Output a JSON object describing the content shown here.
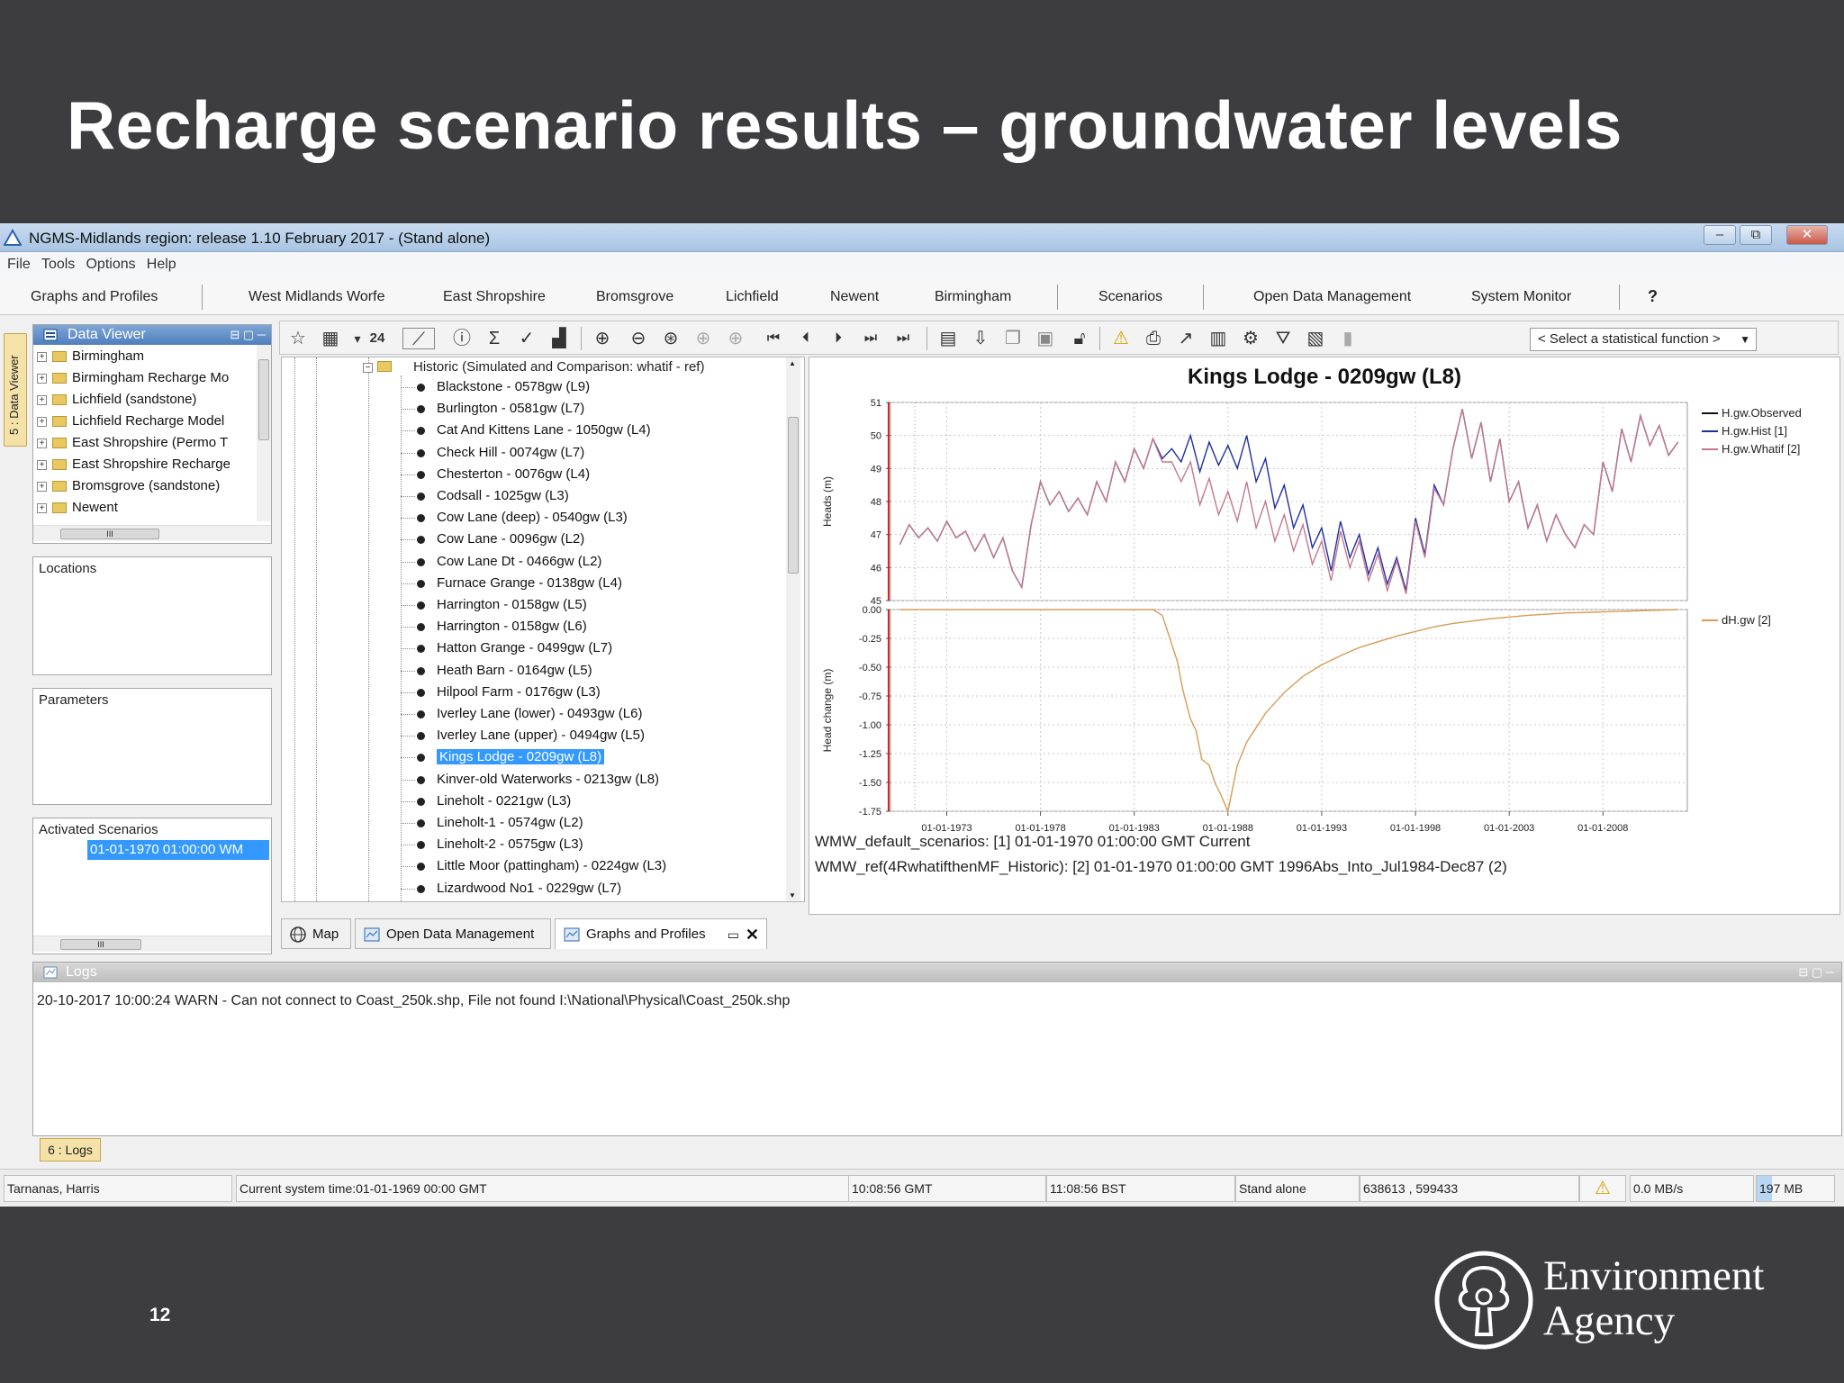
{
  "slide": {
    "title": "Recharge scenario results – groundwater levels",
    "page_number": "12",
    "logo_line1": "Environment",
    "logo_line2": "Agency"
  },
  "window": {
    "title": "NGMS-Midlands region: release 1.10 February 2017 - (Stand alone)",
    "buttons": [
      "–",
      "⧉",
      "✕"
    ]
  },
  "menu": [
    "File",
    "Tools",
    "Options",
    "Help"
  ],
  "tabs": [
    "Graphs and Profiles",
    "West Midlands Worfe",
    "East Shropshire",
    "Bromsgrove",
    "Lichfield",
    "Newent",
    "Birmingham",
    "Scenarios",
    "Open Data Management",
    "System Monitor",
    "?"
  ],
  "side_strip": "5 : Data Viewer",
  "data_viewer": {
    "title": "Data Viewer",
    "items": [
      "Birmingham",
      "Birmingham Recharge Mo",
      "Lichfield (sandstone)",
      "Lichfield Recharge Model",
      "East Shropshire (Permo T",
      "East Shropshire Recharge",
      "Bromsgrove (sandstone)",
      "Newent"
    ],
    "scroll_label": "III"
  },
  "locations_label": "Locations",
  "parameters_label": "Parameters",
  "activated": {
    "label": "Activated Scenarios",
    "item": "01-01-1970 01:00:00  WM",
    "scroll_label": "III"
  },
  "toolbar": {
    "stat_select": "< Select a statistical function >"
  },
  "loc_tree": {
    "root": "Historic (Simulated and Comparison: whatif - ref)",
    "items": [
      "Blackstone - 0578gw (L9)",
      "Burlington - 0581gw (L7)",
      "Cat And Kittens Lane - 1050gw (L4)",
      "Check Hill - 0074gw (L7)",
      "Chesterton - 0076gw (L4)",
      "Codsall - 1025gw (L3)",
      "Cow Lane (deep) - 0540gw (L3)",
      "Cow Lane - 0096gw (L2)",
      "Cow Lane Dt - 0466gw (L2)",
      "Furnace Grange - 0138gw (L4)",
      "Harrington - 0158gw (L5)",
      "Harrington - 0158gw (L6)",
      "Hatton Grange - 0499gw (L7)",
      "Heath Barn - 0164gw (L5)",
      "Hilpool Farm - 0176gw (L3)",
      "Iverley Lane (lower) - 0493gw (L6)",
      "Iverley Lane (upper) - 0494gw (L5)",
      "Kings Lodge - 0209gw (L8)",
      "Kinver-old Waterworks - 0213gw (L8)",
      "Lineholt - 0221gw (L3)",
      "Lineholt-1 - 0574gw (L2)",
      "Lineholt-2 - 0575gw (L3)",
      "Little Moor (pattingham) - 0224gw (L3)",
      "Lizardwood No1 - 0229gw (L7)"
    ],
    "selected_index": 17
  },
  "bottom_tabs": [
    "Map",
    "Open Data Management",
    "Graphs and Profiles"
  ],
  "chart_data": [
    {
      "type": "line",
      "title": "Kings Lodge - 0209gw (L8)",
      "ylabel": "Heads (m)",
      "xlabel": "",
      "ylim": [
        45,
        51
      ],
      "yticks": [
        "45",
        "46",
        "47",
        "48",
        "49",
        "50",
        "51"
      ],
      "xlim": [
        1970.0,
        2012.5
      ],
      "series": [
        {
          "name": "H.gw.Observed",
          "color": "#111111"
        },
        {
          "name": "H.gw.Hist [1]",
          "color": "#1f2fa0",
          "x": [
            1970.5,
            1971.0,
            1971.5,
            1972.0,
            1972.5,
            1973.0,
            1973.5,
            1974.0,
            1974.5,
            1975.0,
            1975.5,
            1976.0,
            1976.5,
            1977.0,
            1977.5,
            1978.0,
            1978.5,
            1979.0,
            1979.5,
            1980.0,
            1980.5,
            1981.0,
            1981.5,
            1982.0,
            1982.5,
            1983.0,
            1983.5,
            1984.0,
            1984.5,
            1985.0,
            1985.5,
            1986.0,
            1986.5,
            1987.0,
            1987.5,
            1988.0,
            1988.5,
            1989.0,
            1989.5,
            1990.0,
            1990.5,
            1991.0,
            1991.5,
            1992.0,
            1992.5,
            1993.0,
            1993.5,
            1994.0,
            1994.5,
            1995.0,
            1995.5,
            1996.0,
            1996.5,
            1997.0,
            1997.5,
            1998.0,
            1998.5,
            1999.0,
            1999.5,
            2000.0,
            2000.5,
            2001.0,
            2001.5,
            2002.0,
            2002.5,
            2003.0,
            2003.5,
            2004.0,
            2004.5,
            2005.0,
            2005.5,
            2006.0,
            2006.5,
            2007.0,
            2007.5,
            2008.0,
            2008.5,
            2009.0,
            2009.5,
            2010.0,
            2010.5,
            2011.0,
            2011.5,
            2012.0
          ],
          "y": [
            46.7,
            47.3,
            46.9,
            47.2,
            46.8,
            47.4,
            46.9,
            47.1,
            46.5,
            47.0,
            46.3,
            46.9,
            45.9,
            45.4,
            47.3,
            48.6,
            47.9,
            48.3,
            47.7,
            48.1,
            47.6,
            48.6,
            48.0,
            49.2,
            48.6,
            49.6,
            49.0,
            49.9,
            49.3,
            49.6,
            49.2,
            50.0,
            48.9,
            49.8,
            49.1,
            49.7,
            49.0,
            50.0,
            48.6,
            49.3,
            47.8,
            48.5,
            47.2,
            47.9,
            46.6,
            47.2,
            45.9,
            47.4,
            46.3,
            47.0,
            45.8,
            46.6,
            45.5,
            46.3,
            45.3,
            47.5,
            46.4,
            48.5,
            47.9,
            49.6,
            50.8,
            49.3,
            50.4,
            48.6,
            49.9,
            48.0,
            48.6,
            47.2,
            47.9,
            46.8,
            47.6,
            47.0,
            46.6,
            47.3,
            47.0,
            49.2,
            48.3,
            50.2,
            49.2,
            50.6,
            49.7,
            50.3,
            49.4,
            49.8
          ]
        },
        {
          "name": "H.gw.Whatif [2]",
          "color": "#c3788b",
          "x": [
            1970.5,
            1971.0,
            1971.5,
            1972.0,
            1972.5,
            1973.0,
            1973.5,
            1974.0,
            1974.5,
            1975.0,
            1975.5,
            1976.0,
            1976.5,
            1977.0,
            1977.5,
            1978.0,
            1978.5,
            1979.0,
            1979.5,
            1980.0,
            1980.5,
            1981.0,
            1981.5,
            1982.0,
            1982.5,
            1983.0,
            1983.5,
            1984.0,
            1984.5,
            1985.0,
            1985.5,
            1986.0,
            1986.5,
            1987.0,
            1987.5,
            1988.0,
            1988.5,
            1989.0,
            1989.5,
            1990.0,
            1990.5,
            1991.0,
            1991.5,
            1992.0,
            1992.5,
            1993.0,
            1993.5,
            1994.0,
            1994.5,
            1995.0,
            1995.5,
            1996.0,
            1996.5,
            1997.0,
            1997.5,
            1998.0,
            1998.5,
            1999.0,
            1999.5,
            2000.0,
            2000.5,
            2001.0,
            2001.5,
            2002.0,
            2002.5,
            2003.0,
            2003.5,
            2004.0,
            2004.5,
            2005.0,
            2005.5,
            2006.0,
            2006.5,
            2007.0,
            2007.5,
            2008.0,
            2008.5,
            2009.0,
            2009.5,
            2010.0,
            2010.5,
            2011.0,
            2011.5,
            2012.0
          ],
          "y": [
            46.7,
            47.3,
            46.9,
            47.2,
            46.8,
            47.4,
            46.9,
            47.1,
            46.5,
            47.0,
            46.3,
            46.9,
            45.9,
            45.4,
            47.3,
            48.6,
            47.9,
            48.3,
            47.7,
            48.1,
            47.6,
            48.6,
            48.0,
            49.2,
            48.6,
            49.6,
            49.0,
            49.9,
            49.2,
            49.2,
            48.6,
            49.2,
            47.9,
            48.7,
            47.6,
            48.3,
            47.4,
            48.6,
            47.2,
            48.0,
            46.8,
            47.6,
            46.5,
            47.3,
            46.1,
            46.8,
            45.6,
            47.1,
            46.0,
            46.8,
            45.6,
            46.4,
            45.3,
            46.2,
            45.2,
            47.4,
            46.3,
            48.4,
            47.9,
            49.6,
            50.8,
            49.3,
            50.4,
            48.6,
            49.9,
            48.0,
            48.6,
            47.2,
            47.9,
            46.8,
            47.6,
            47.0,
            46.6,
            47.3,
            47.0,
            49.2,
            48.3,
            50.2,
            49.2,
            50.6,
            49.7,
            50.3,
            49.4,
            49.8
          ]
        }
      ]
    },
    {
      "type": "line",
      "title": "",
      "ylabel": "Head change (m)",
      "xlabel": "",
      "ylim": [
        -1.75,
        0.0
      ],
      "yticks": [
        "0.00",
        "-0.25",
        "-0.50",
        "-0.75",
        "-1.00",
        "-1.25",
        "-1.50",
        "-1.75"
      ],
      "xlim": [
        1970.0,
        2012.5
      ],
      "xticks": [
        "01-01-1973",
        "01-01-1978",
        "01-01-1983",
        "01-01-1988",
        "01-01-1993",
        "01-01-1998",
        "01-01-2003",
        "01-01-2008"
      ],
      "series": [
        {
          "name": "dH.gw [2]",
          "color": "#d89c56",
          "x": [
            1970.5,
            1984.0,
            1984.5,
            1985.0,
            1985.3,
            1985.6,
            1986.0,
            1986.3,
            1986.6,
            1987.0,
            1987.3,
            1987.6,
            1988.0,
            1988.5,
            1989.0,
            1990.0,
            1991.0,
            1992.0,
            1993.0,
            1994.0,
            1995.0,
            1996.0,
            1997.0,
            1998.0,
            1999.0,
            2000.0,
            2002.0,
            2004.0,
            2006.0,
            2008.0,
            2010.0,
            2012.0
          ],
          "y": [
            0.0,
            0.0,
            -0.05,
            -0.3,
            -0.45,
            -0.7,
            -0.95,
            -1.05,
            -1.3,
            -1.35,
            -1.5,
            -1.6,
            -1.75,
            -1.35,
            -1.15,
            -0.9,
            -0.72,
            -0.58,
            -0.48,
            -0.4,
            -0.33,
            -0.28,
            -0.23,
            -0.19,
            -0.15,
            -0.12,
            -0.08,
            -0.05,
            -0.03,
            -0.02,
            -0.01,
            0.0
          ]
        }
      ]
    }
  ],
  "captions": [
    "WMW_default_scenarios: [1] 01-01-1970 01:00:00 GMT Current",
    "WMW_ref(4RwhatifthenMF_Historic): [2] 01-01-1970 01:00:00 GMT 1996Abs_Into_Jul1984-Dec87 (2)"
  ],
  "logs": {
    "title": "Logs",
    "line": "20-10-2017 10:00:24 WARN - Can not connect to Coast_250k.shp, File not found I:\\National\\Physical\\Coast_250k.shp",
    "tab_label": "6 : Logs"
  },
  "status": {
    "user": "Tarnanas, Harris",
    "system_time": "Current system time:01-01-1969 00:00 GMT",
    "gmt": "10:08:56 GMT",
    "bst": "11:08:56 BST",
    "mode": "Stand alone",
    "coords": "638613 , 599433",
    "rate": "0.0 MB/s",
    "memory": "197 MB",
    "memory_fraction": 0.2
  },
  "colors": {
    "accent": "#3399ff",
    "slide_bg": "#3d3d3f",
    "warn": "#f2c200"
  }
}
